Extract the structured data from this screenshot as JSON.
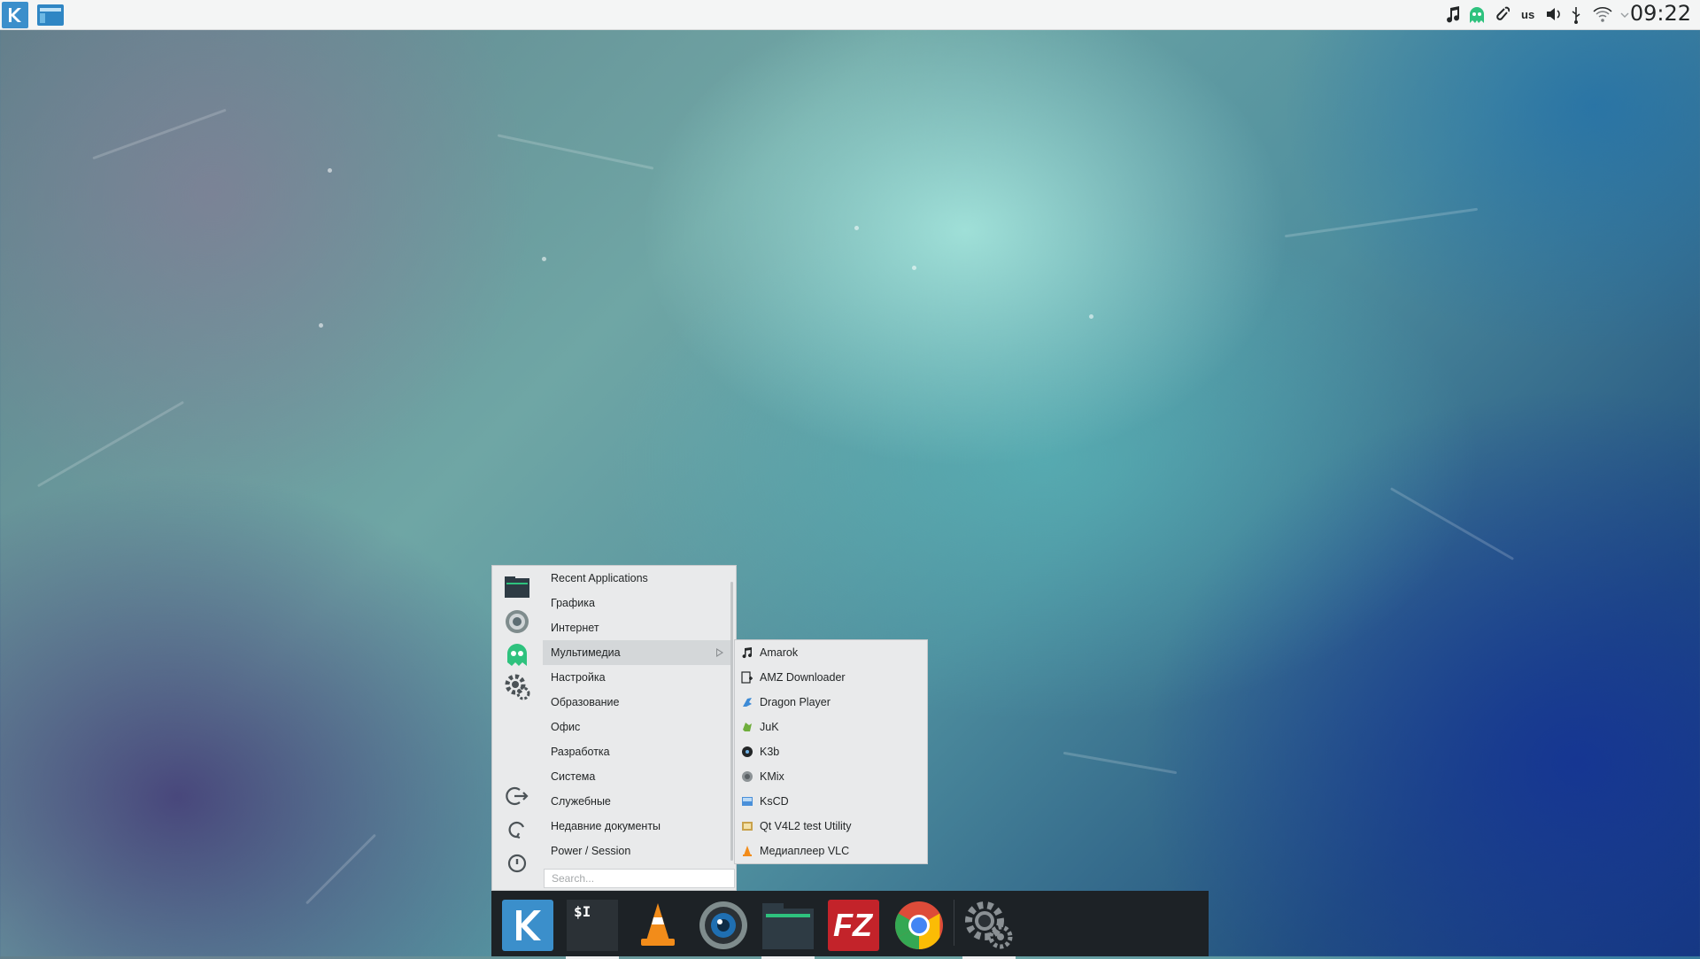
{
  "top_panel": {
    "tray": {
      "keyboard_layout": "us",
      "clock": "09:22"
    },
    "icons": [
      "kde-icon",
      "window-icon",
      "music-note-icon",
      "ghost-icon",
      "clip-icon",
      "speaker-icon",
      "usb-icon",
      "wifi-icon",
      "expand-icon"
    ]
  },
  "app_menu": {
    "categories": [
      {
        "label": "Recent Applications"
      },
      {
        "label": "Графика"
      },
      {
        "label": "Интернет"
      },
      {
        "label": "Мультимедиа",
        "active": true
      },
      {
        "label": "Настройка"
      },
      {
        "label": "Образование"
      },
      {
        "label": "Офис"
      },
      {
        "label": "Разработка"
      },
      {
        "label": "Система"
      },
      {
        "label": "Служебные"
      },
      {
        "label": "Недавние документы"
      },
      {
        "label": "Power / Session"
      }
    ],
    "search_placeholder": "Search...",
    "sidebar_icons": [
      "file-manager-icon",
      "camera-icon",
      "ghost-icon",
      "settings-icon",
      "logout-icon",
      "restart-icon",
      "power-icon"
    ]
  },
  "submenu": {
    "items": [
      {
        "label": "Amarok",
        "icon": "music-note-icon"
      },
      {
        "label": "AMZ Downloader",
        "icon": "download-icon"
      },
      {
        "label": "Dragon Player",
        "icon": "dragon-icon"
      },
      {
        "label": "JuK",
        "icon": "juk-icon"
      },
      {
        "label": "K3b",
        "icon": "disc-icon"
      },
      {
        "label": "KMix",
        "icon": "mixer-icon"
      },
      {
        "label": "KsCD",
        "icon": "cd-icon"
      },
      {
        "label": "Qt V4L2 test Utility",
        "icon": "video-icon"
      },
      {
        "label": "Медиаплеер VLC",
        "icon": "vlc-icon"
      }
    ]
  },
  "taskbar": {
    "apps": [
      "kde-launcher",
      "terminal",
      "vlc",
      "camera",
      "file-manager",
      "filezilla",
      "chrome",
      "settings"
    ],
    "terminal_glyph": "$I",
    "filezilla_glyph": "FZ"
  },
  "colors": {
    "panel_bg": "#f4f5f5",
    "menu_bg": "#e9eaeb",
    "taskbar_bg": "#1d2226",
    "accent": "#3b8fcb"
  }
}
